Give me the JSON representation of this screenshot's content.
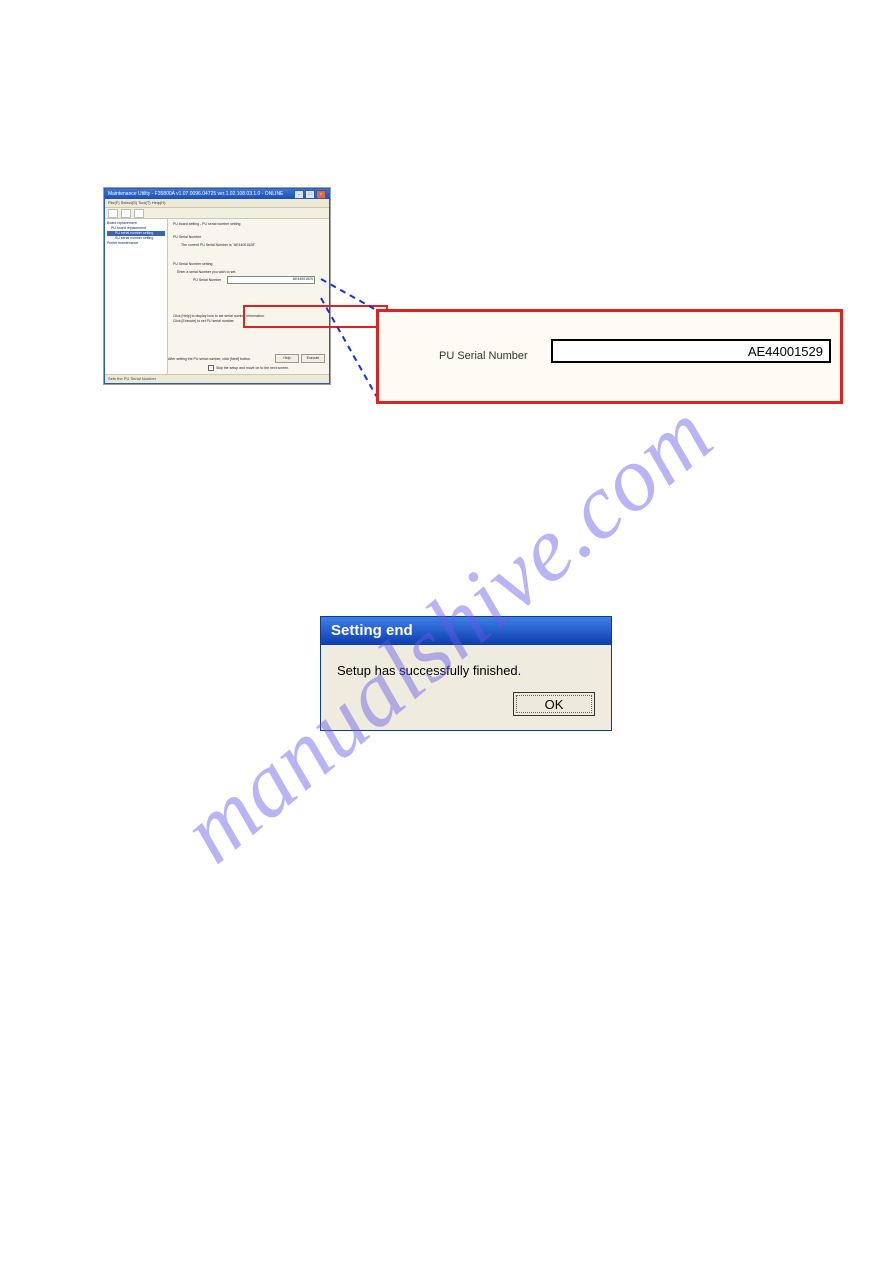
{
  "watermark": "manualshive.com",
  "appwin": {
    "title": "Maintenance Utility - F35800A v1.07.0096.04725 ver.1.02.108.03.1.0 - ONLINE",
    "menubar": "File(F)  Select(S)  Tool(T)  Help(H)",
    "tree": {
      "item1": "Board replacement",
      "item2": "PU board replacement",
      "item3_sel": "PU serial number setting",
      "item4": "SU serial number setting",
      "item5": "Printer maintenance"
    },
    "main": {
      "heading": "PU board setting - PU serial number setting",
      "topblocklabel": "PU Serial Number",
      "topblocktext": "The current PU Serial Number is \"AE44001528\"",
      "secblocklabel": "PU Serial Number setting",
      "instr1": "Enter a   serial Number you wish to set.",
      "sn_label": "PU Serial Number",
      "sn_value": "AE44001529",
      "help1": "Click [Help] to display how to set serial number information.",
      "help2": "Click [Execute] to set PU serial number.",
      "btn_help": "Help",
      "btn_exec": "Execute",
      "after": "After setting the PU serial number, click [Next] button.",
      "skip": "Skip the setup and move on to the next screen."
    },
    "statusbar": "Sets the PU Serial Number"
  },
  "zoom": {
    "tinylbl": "",
    "label": "PU Serial Number",
    "value": "AE44001529"
  },
  "msgdlg": {
    "title": "Setting end",
    "message": "Setup has successfully finished.",
    "ok": "OK"
  }
}
